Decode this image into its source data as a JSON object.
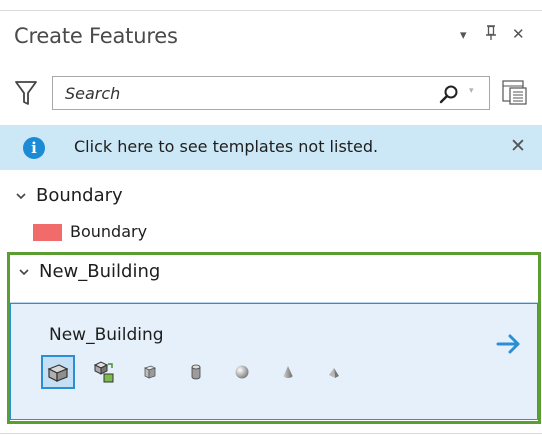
{
  "pane": {
    "title": "Create Features",
    "controls": {
      "menu_glyph": "▾",
      "pin_glyph": "⫨",
      "close_glyph": "✕"
    }
  },
  "search": {
    "placeholder": "Search",
    "value": "",
    "dropdown_glyph": "▾"
  },
  "info_bar": {
    "icon_glyph": "i",
    "message": "Click here to see templates not listed.",
    "close_glyph": "✕"
  },
  "groups": [
    {
      "name": "Boundary",
      "expanded": true,
      "templates": [
        {
          "label": "Boundary",
          "swatch_color": "#f26b6b"
        }
      ]
    },
    {
      "name": "New_Building",
      "expanded": true,
      "selected_template": {
        "label": "New_Building",
        "tools": [
          {
            "icon": "multipatch-box-icon",
            "active": true
          },
          {
            "icon": "import-model-icon",
            "active": false
          },
          {
            "icon": "cube-icon",
            "active": false
          },
          {
            "icon": "cylinder-icon",
            "active": false
          },
          {
            "icon": "sphere-icon",
            "active": false
          },
          {
            "icon": "cone-icon",
            "active": false
          },
          {
            "icon": "tetrahedron-icon",
            "active": false
          }
        ]
      }
    }
  ],
  "colors": {
    "accent": "#2c8fd6",
    "info_background": "#cce8f6",
    "highlight_frame": "#5a9e32",
    "selected_background": "#e6f0fa"
  }
}
